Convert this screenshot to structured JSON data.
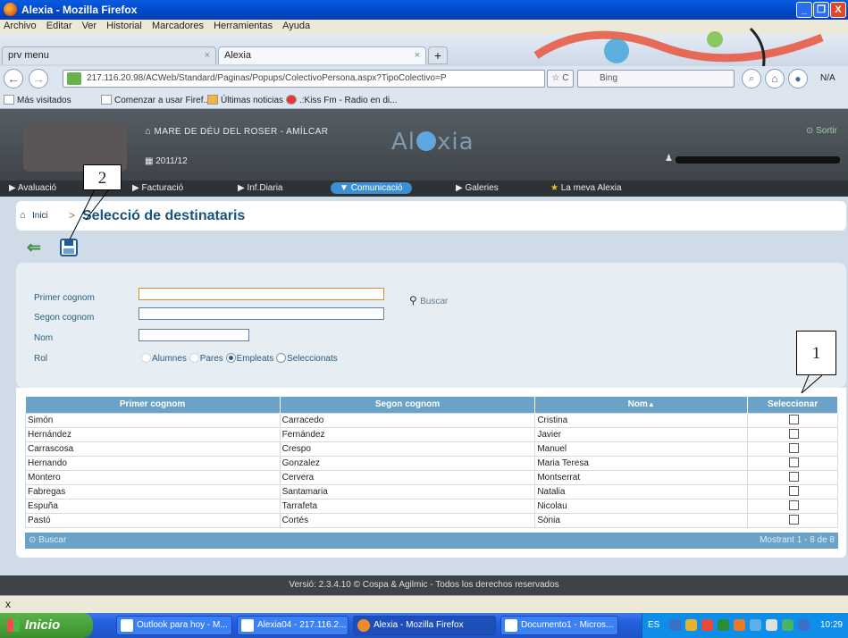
{
  "window": {
    "title": "Alexia - Mozilla Firefox",
    "buttons": [
      "_",
      "❐",
      "X"
    ]
  },
  "menubar": [
    "Archivo",
    "Editar",
    "Ver",
    "Historial",
    "Marcadores",
    "Herramientas",
    "Ayuda"
  ],
  "tabs": [
    {
      "label": "prv menu",
      "close": "×"
    },
    {
      "label": "Alexia",
      "close": "×"
    }
  ],
  "new_tab": "+",
  "url": "217.116.20.98/ACWeb/Standard/Paginas/Popups/ColectivoPersona.aspx?TipoColectivo=P",
  "search_engine": "Bing",
  "na_label": "N/A",
  "bookmarks": [
    "Más visitados",
    "Comenzar a usar Firef...",
    "Últimas noticias",
    ".:Kiss Fm - Radio en di..."
  ],
  "header": {
    "school": "MARE DE DÉU DEL ROSER - AMÍLCAR",
    "year": "2011/12",
    "brand_left": "Al",
    "brand_right": "xia",
    "logout": "Sortir"
  },
  "nav": [
    {
      "label": "Avaluació"
    },
    {
      "label": "Facturació"
    },
    {
      "label": "Inf.Diaria"
    },
    {
      "label": "Comunicació"
    },
    {
      "label": "Galeries"
    },
    {
      "label": "La meva Alexia"
    }
  ],
  "breadcrumb": {
    "home": "Inici",
    "separator": ">",
    "title": "Selecció de destinataris"
  },
  "filters": {
    "first_surname_label": "Primer cognom",
    "second_surname_label": "Segon cognom",
    "name_label": "Nom",
    "role_label": "Rol",
    "search_label": "Buscar",
    "roles": [
      "Alumnes",
      "Pares",
      "Empleats",
      "Seleccionats"
    ],
    "selected_role": "Empleats"
  },
  "grid": {
    "columns": [
      "Primer cognom",
      "Segon cognom",
      "Nom",
      "Seleccionar"
    ],
    "sort_indicator": "▲",
    "rows": [
      [
        "Simón",
        "Carracedo",
        "Cristina"
      ],
      [
        "Hernández",
        "Fernández",
        "Javier"
      ],
      [
        "Carrascosa",
        "Crespo",
        "Manuel"
      ],
      [
        "Hernando",
        "Gonzalez",
        "Maria Teresa"
      ],
      [
        "Montero",
        "Cervera",
        "Montserrat"
      ],
      [
        "Fabregas",
        "Santamaria",
        "Natalia"
      ],
      [
        "Espuña",
        "Tarrafeta",
        "Nicolau"
      ],
      [
        "Pastó",
        "Cortés",
        "Sònia"
      ]
    ],
    "footer_search": "Buscar",
    "footer_count": "Mostrant 1 - 8 de 8"
  },
  "footer": "Versió: 2.3.4.10 © Cospa & Agilmic - Todos los derechos reservados",
  "callouts": {
    "save": "2",
    "select_column": "1"
  },
  "statusbar": {
    "close": "x"
  },
  "taskbar": {
    "start": "Inicio",
    "tasks": [
      "Outlook para hoy - M...",
      "Alexia04 - 217.116.2...",
      "Alexia - Mozilla Firefox",
      "Documento1 - Micros..."
    ],
    "lang": "ES",
    "clock": "10:29"
  },
  "colors": {
    "header": "#4a5157",
    "nav_selected": "#3b8fd2",
    "grid_header": "#6aa3c7",
    "title": "#17537e"
  }
}
